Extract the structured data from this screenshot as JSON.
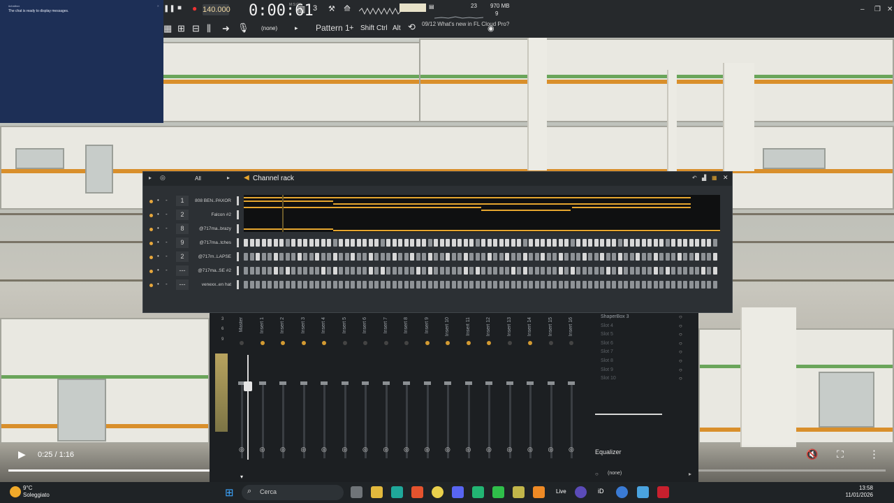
{
  "chat": {
    "title": "#chatbox",
    "message": "The chat is ready to display messages."
  },
  "toolbar": {
    "tempo": "140.000",
    "time": "0:00:61",
    "time_unit": "M:S:CS",
    "cpu": "23",
    "memory": "970 MB",
    "polyphony": "9",
    "input_none": "(none)",
    "pattern": "Pattern 1",
    "shift": "Shift",
    "ctrl": "Ctrl",
    "alt": "Alt",
    "news_date": "09/12",
    "news_text": "What's new in FL Cloud Pro?"
  },
  "rack": {
    "filter": "All",
    "title": "Channel rack",
    "channels": [
      {
        "num": "1",
        "name": "808 BEN..PAXOR"
      },
      {
        "num": "2",
        "name": "Falcon #2"
      },
      {
        "num": "8",
        "name": "@717ma..brazy"
      },
      {
        "num": "9",
        "name": "@717ma..tches"
      },
      {
        "num": "2",
        "name": "@717m..LAPSE"
      },
      {
        "num": "---",
        "name": "@717ma..SE #2"
      },
      {
        "num": "---",
        "name": "venexx..en hat"
      }
    ]
  },
  "mixer": {
    "tracks": [
      "Master",
      "Insert 1",
      "Insert 2",
      "Insert 3",
      "Insert 4",
      "Insert 5",
      "Insert 6",
      "Insert 7",
      "Insert 8",
      "Insert 9",
      "Insert 10",
      "Insert 11",
      "Insert 12",
      "Insert 13",
      "Insert 14",
      "Insert 15",
      "Insert 16"
    ],
    "slots": [
      "ShaperBox 3",
      "Slot 4",
      "Slot 5",
      "Slot 6",
      "Slot 7",
      "Slot 8",
      "Slot 9",
      "Slot 10"
    ],
    "eq_label": "Equalizer",
    "output": "(none)",
    "scale": [
      "3",
      "6",
      "9"
    ]
  },
  "video": {
    "time": "0:25 / 1:16",
    "progress": 0.329
  },
  "taskbar": {
    "temp": "9°C",
    "weather": "Soleggiato",
    "search": "Cerca",
    "live": "Live",
    "time": "13:58",
    "date": "11/01/2026"
  },
  "colors": {
    "accent": "#e6a62f",
    "chat_bg": "#1d2f56"
  }
}
